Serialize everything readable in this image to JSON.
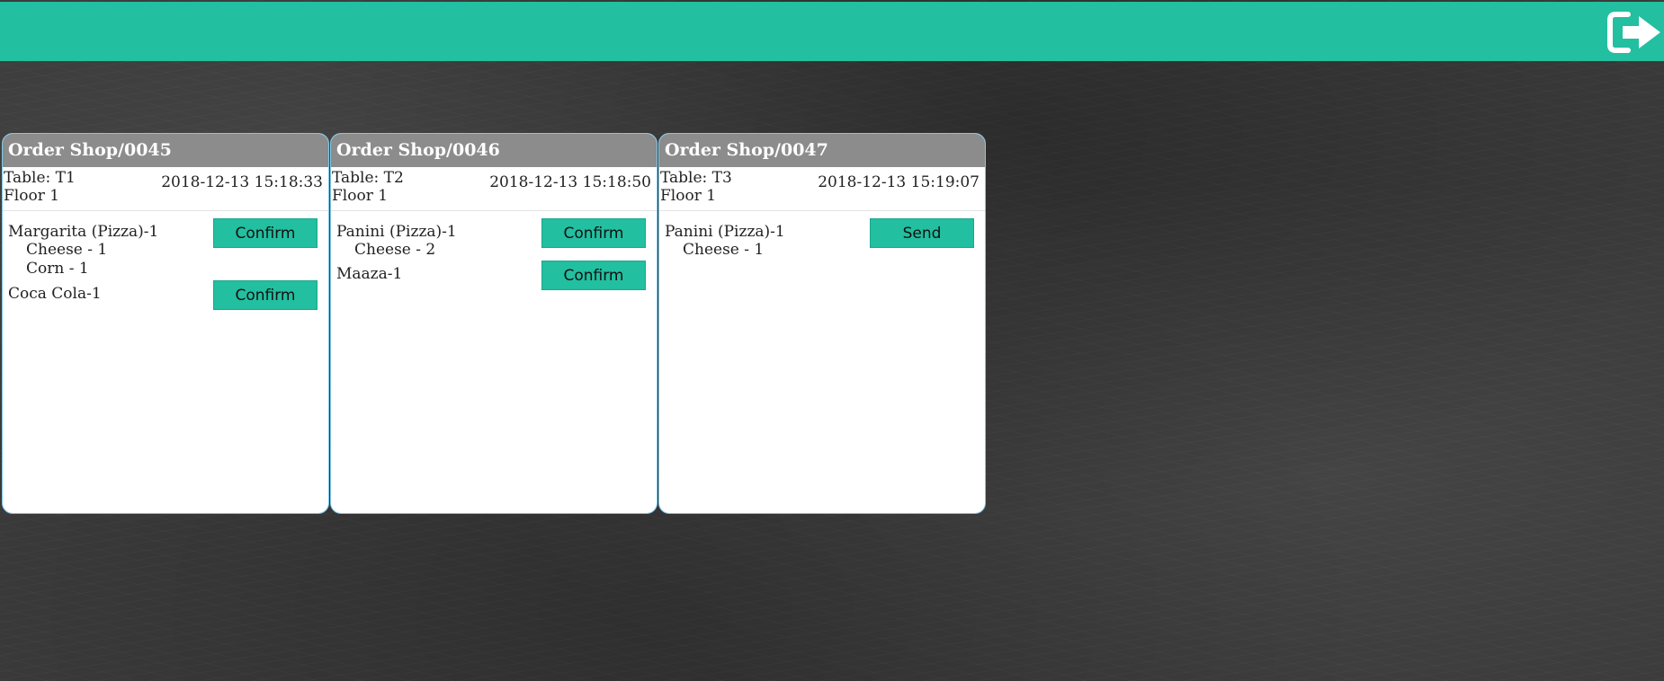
{
  "header": {
    "logout_icon": "sign-out-icon",
    "color": "#22bfa0"
  },
  "orders": [
    {
      "title": "Order Shop/0045",
      "table": "Table: T1",
      "floor": "Floor 1",
      "time": "2018-12-13 15:18:33",
      "items": [
        {
          "name": "Margarita (Pizza)-1",
          "button": "Confirm",
          "mods": [
            "Cheese - 1",
            "Corn - 1"
          ]
        },
        {
          "name": "Coca Cola-1",
          "button": "Confirm",
          "mods": []
        }
      ]
    },
    {
      "title": "Order Shop/0046",
      "table": "Table: T2",
      "floor": "Floor 1",
      "time": "2018-12-13 15:18:50",
      "items": [
        {
          "name": "Panini (Pizza)-1",
          "button": "Confirm",
          "mods": [
            "Cheese - 2"
          ]
        },
        {
          "name": "Maaza-1",
          "button": "Confirm",
          "mods": []
        }
      ]
    },
    {
      "title": "Order Shop/0047",
      "table": "Table: T3",
      "floor": "Floor 1",
      "time": "2018-12-13 15:19:07",
      "items": [
        {
          "name": "Panini (Pizza)-1",
          "button": "Send",
          "mods": [
            "Cheese - 1"
          ]
        }
      ]
    }
  ]
}
